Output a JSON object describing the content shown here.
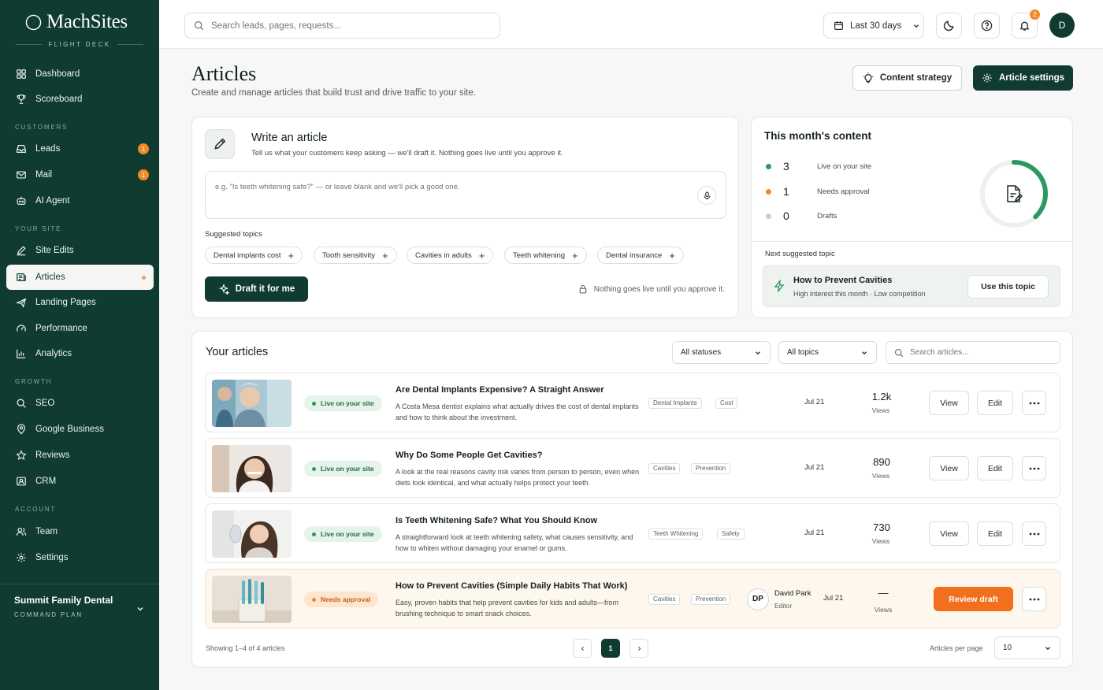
{
  "brand": {
    "name": "MachSites",
    "tagline": "FLIGHT DECK"
  },
  "sidebar": {
    "sections": [
      "CUSTOMERS",
      "YOUR SITE",
      "GROWTH",
      "ACCOUNT"
    ],
    "items": [
      {
        "label": "Dashboard",
        "icon": "grid-icon"
      },
      {
        "label": "Scoreboard",
        "icon": "trophy-icon"
      },
      {
        "label": "Leads",
        "icon": "inbox-icon",
        "badge": "1"
      },
      {
        "label": "Mail",
        "icon": "mail-icon",
        "badge": "1"
      },
      {
        "label": "AI Agent",
        "icon": "bot-icon"
      },
      {
        "label": "Site Edits",
        "icon": "pen-icon"
      },
      {
        "label": "Articles",
        "icon": "newspaper-icon",
        "active": true
      },
      {
        "label": "Landing Pages",
        "icon": "plane-icon"
      },
      {
        "label": "Performance",
        "icon": "gauge-icon"
      },
      {
        "label": "Analytics",
        "icon": "bar-chart-icon"
      },
      {
        "label": "SEO",
        "icon": "search-icon"
      },
      {
        "label": "Google Business",
        "icon": "map-pin-icon"
      },
      {
        "label": "Reviews",
        "icon": "star-icon"
      },
      {
        "label": "CRM",
        "icon": "crm-icon"
      },
      {
        "label": "Team",
        "icon": "users-icon"
      },
      {
        "label": "Settings",
        "icon": "gear-icon"
      }
    ],
    "workspace": {
      "name": "Summit Family Dental",
      "plan": "COMMAND PLAN"
    }
  },
  "topbar": {
    "search_placeholder": "Search leads, pages, requests...",
    "date_range": "Last 30 days",
    "notification_count": "2",
    "avatar_initial": "D"
  },
  "header": {
    "title": "Articles",
    "subtitle": "Create and manage articles that build trust and drive traffic to your site.",
    "content_strategy": "Content strategy",
    "article_settings": "Article settings"
  },
  "write": {
    "title": "Write an article",
    "subtitle": "Tell us what your customers keep asking — we'll draft it. Nothing goes live until you approve it.",
    "placeholder": "e.g. \"Is teeth whitening safe?\" — or leave blank and we'll pick a good one.",
    "suggested_label": "Suggested topics",
    "topics": [
      "Dental implants cost",
      "Tooth sensitivity",
      "Cavities in adults",
      "Teeth whitening",
      "Dental insurance"
    ],
    "draft_button": "Draft it for me",
    "approve_note": "Nothing goes live until you approve it."
  },
  "month": {
    "title": "This month's content",
    "stats": [
      {
        "value": "3",
        "label": "Live on your site",
        "color": "#2a9a5e"
      },
      {
        "value": "1",
        "label": "Needs approval",
        "color": "#f08a24"
      },
      {
        "value": "0",
        "label": "Drafts",
        "color": "#c8cdca"
      }
    ],
    "progress": 0.38,
    "next_label": "Next suggested topic",
    "next_title": "How to Prevent Cavities",
    "next_sub": "High interest this month · Low competition",
    "use_button": "Use this topic"
  },
  "articles": {
    "title": "Your articles",
    "status_filter": "All statuses",
    "topic_filter": "All topics",
    "search_placeholder": "Search articles...",
    "rows": [
      {
        "status": "Live on your site",
        "title": "Are Dental Implants Expensive? A Straight Answer",
        "desc": "A Costa Mesa dentist explains what actually drives the cost of dental implants and how to think about the investment.",
        "tags": [
          "Dental Implants",
          "Cost"
        ],
        "date": "Jul 21",
        "views": "1.2k",
        "views_label": "Views",
        "view": "View",
        "edit": "Edit"
      },
      {
        "status": "Live on your site",
        "title": "Why Do Some People Get Cavities?",
        "desc": "A look at the real reasons cavity risk varies from person to person, even when diets look identical, and what actually helps protect your teeth.",
        "tags": [
          "Cavities",
          "Prevention"
        ],
        "date": "Jul 21",
        "views": "890",
        "views_label": "Views",
        "view": "View",
        "edit": "Edit"
      },
      {
        "status": "Live on your site",
        "title": "Is Teeth Whitening Safe? What You Should Know",
        "desc": "A straightforward look at teeth whitening safety, what causes sensitivity, and how to whiten without damaging your enamel or gums.",
        "tags": [
          "Teeth Whitening",
          "Safety"
        ],
        "date": "Jul 21",
        "views": "730",
        "views_label": "Views",
        "view": "View",
        "edit": "Edit"
      },
      {
        "status": "Needs approval",
        "title": "How to Prevent Cavities (Simple Daily Habits That Work)",
        "desc": "Easy, proven habits that help prevent cavities for kids and adults—from brushing technique to smart snack choices.",
        "tags": [
          "Cavities",
          "Prevention"
        ],
        "editor_initials": "DP",
        "editor_name": "David Park",
        "editor_role": "Editor",
        "date": "Jul 21",
        "views": "—",
        "views_label": "Views",
        "review": "Review draft"
      }
    ],
    "showing": "Showing 1–4 of 4 articles",
    "page": "1",
    "per_page_label": "Articles per page",
    "per_page": "10"
  }
}
